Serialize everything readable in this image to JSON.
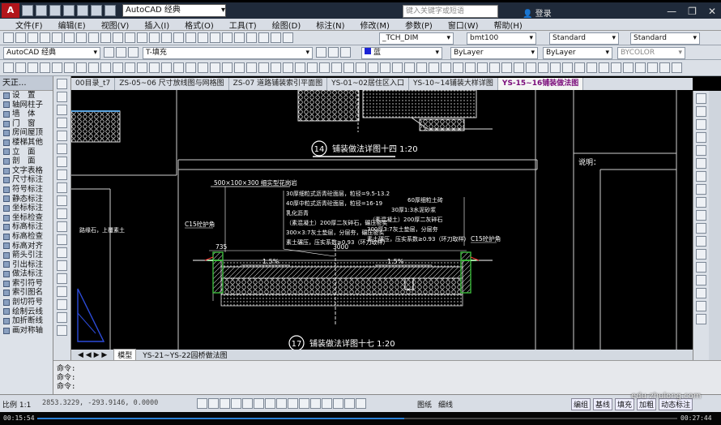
{
  "app": {
    "workspace": "AutoCAD 经典",
    "search_placeholder": "键入关键字或短语",
    "login": "登录"
  },
  "menu": [
    "文件(F)",
    "编辑(E)",
    "视图(V)",
    "插入(I)",
    "格式(O)",
    "工具(T)",
    "绘图(D)",
    "标注(N)",
    "修改(M)",
    "参数(P)",
    "窗口(W)",
    "帮助(H)"
  ],
  "toolbar": {
    "text_style": "_TCH_DIM",
    "dim_style": "bmt100",
    "table_style": "Standard",
    "multileader_style": "Standard",
    "workspace2": "AutoCAD 经典",
    "layer": "T-填充",
    "color": "蓝",
    "linetype": "ByLayer",
    "lineweight": "ByLayer",
    "plotstyle": "BYCOLOR"
  },
  "tianzheng": {
    "title": "天正...",
    "items": [
      "设　置",
      "轴网柱子",
      "墙　体",
      "门　窗",
      "房间屋顶",
      "楼梯其他",
      "立　面",
      "剖　面",
      "文字表格",
      "尺寸标注",
      "符号标注",
      "静态标注",
      "坐标标注",
      "坐标检查",
      "标高标注",
      "标高检查",
      "标高对齐",
      "箭头引注",
      "引出标注",
      "做法标注",
      "索引符号",
      "索引图名",
      "剖切符号",
      "绘制云线",
      "加折断线",
      "画对称轴"
    ]
  },
  "doc_tabs": [
    "00目录_t7",
    "ZS-05~06 尺寸放线图与网格图",
    "ZS-07 道路铺装索引平面图",
    "YS-01~02居住区入口",
    "YS-10~14铺装大样详图",
    "YS-15~16铺装做法图"
  ],
  "active_doc_tab": "YS-15~16铺装做法图",
  "layout_tabs": [
    "模型",
    "YS-21~YS-22园桥做法图"
  ],
  "drawing": {
    "detail14_title": "铺装做法详图十四 1:20",
    "detail14_no": "14",
    "detail17_title": "铺装做法详图十七 1:20",
    "detail17_no": "17",
    "note_title": "说明：",
    "dim_total": "3000",
    "dim_side": "735",
    "slope": "1.5%",
    "curb_label": "C15砼护角",
    "curb_note": "500×100×300 细实型花岗岩",
    "left_layers": [
      "30厚细粒式沥青砼面层，粒径=9.5-13.2",
      "40厚中粒式沥青砼面层，粒径=16-19",
      "乳化沥青",
      "（素混凝土）200厚二灰碎石，碾压密实",
      "300×3:7灰土垫层，分层夯，碾压密实",
      "素土碾压，压实系数≥0.93（环刀取样）"
    ],
    "right_layers": [
      "60厚细粒土砖",
      "30厚1:3水泥砂浆",
      "（素混凝土）200厚二灰碎石",
      "300厚3:7灰土垫层，分层夯",
      "素土碾压，压实系数≥0.93（环刀取样）"
    ],
    "left_edge_note": "路缘石，上覆素土"
  },
  "command": {
    "line1": "命令:",
    "line2": "命令:",
    "prompt": "命令:"
  },
  "status": {
    "scale": "比例 1:1",
    "coords": "2853.3229, -293.9146, 0.0000",
    "right_items": [
      "图纸",
      "细线",
      "填充",
      "加粗",
      "动态标注"
    ],
    "labels": [
      "模型",
      "编组",
      "基线",
      "填充",
      "加粗",
      "动态标注"
    ]
  },
  "watermark": "edu-zhulong.com",
  "player": {
    "elapsed": "00:15:54",
    "total": "00:27:44",
    "progress_fraction": 0.573
  }
}
